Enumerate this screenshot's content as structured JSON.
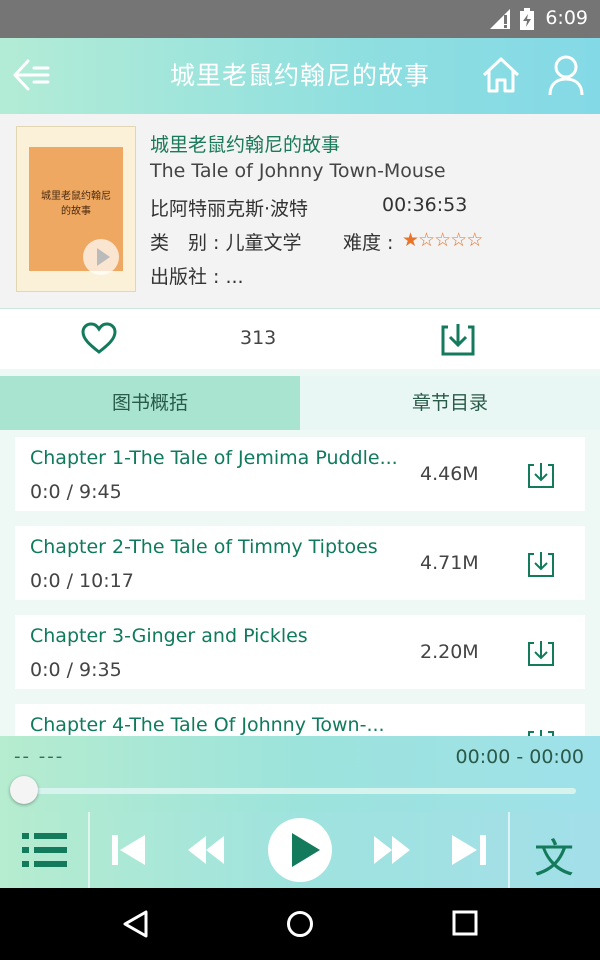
{
  "status_bar": {
    "time": "6:09"
  },
  "header": {
    "title": "城里老鼠约翰尼的故事",
    "back_icon": "back-arrow-icon",
    "home_icon": "home-icon",
    "user_icon": "user-icon"
  },
  "book": {
    "title_zh": "城里老鼠约翰尼的故事",
    "title_en": "The Tale of Johnny Town-Mouse",
    "author": "比阿特丽克斯·波特",
    "duration": "00:36:53",
    "category": "类　别 : 儿童文学",
    "difficulty_label": "难度 :",
    "difficulty_rating": 1,
    "difficulty_max": 5,
    "publisher": "出版社 : ...",
    "cover_text": "城里老鼠约翰尼的故事"
  },
  "actions": {
    "like_count": "313",
    "like_icon": "heart-icon",
    "download_icon": "download-icon"
  },
  "tabs": [
    {
      "label": "图书概括",
      "active": true
    },
    {
      "label": "章节目录",
      "active": false
    }
  ],
  "chapters": [
    {
      "name": "Chapter 1-The Tale of Jemima Puddle...",
      "progress": "0:0 / 9:45",
      "size": "4.46M"
    },
    {
      "name": "Chapter 2-The Tale of Timmy Tiptoes",
      "progress": "0:0 / 10:17",
      "size": "4.71M"
    },
    {
      "name": "Chapter 3-Ginger and Pickles",
      "progress": "0:0 / 9:35",
      "size": "2.20M"
    },
    {
      "name": "Chapter 4-The Tale Of Johnny Town-...",
      "progress": "",
      "size": ""
    }
  ],
  "player": {
    "track": "-- ---",
    "time": "00:00 - 00:00",
    "progress": 0
  },
  "controls": {
    "text_button": "文",
    "playlist_icon": "playlist-icon",
    "prev_icon": "skip-previous-icon",
    "rewind_icon": "rewind-icon",
    "play_icon": "play-icon",
    "forward_icon": "fast-forward-icon",
    "next_icon": "skip-next-icon"
  },
  "colors": {
    "accent": "#147a5c",
    "star": "#e8742a"
  }
}
